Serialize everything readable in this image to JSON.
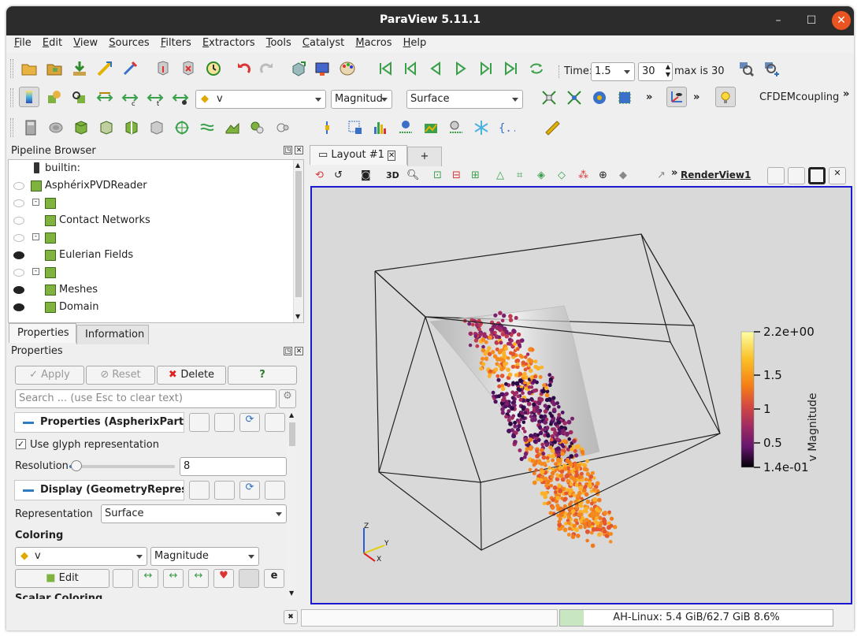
{
  "window": {
    "title": "ParaView 5.11.1"
  },
  "menu": [
    "File",
    "Edit",
    "View",
    "Sources",
    "Filters",
    "Extractors",
    "Tools",
    "Catalyst",
    "Macros",
    "Help"
  ],
  "toolbar_time": {
    "time_label": "Time:",
    "time_value": "1.5",
    "step_value": "30",
    "max_label": "max is 30"
  },
  "toolbar_color": {
    "array_value": "v",
    "component_value": "Magnitud",
    "representation_value": "Surface",
    "more": "»",
    "plugin_label": "CFDEMcoupling",
    "more2": "»"
  },
  "pipeline": {
    "title": "Pipeline Browser",
    "items": [
      {
        "label": "builtin:",
        "visible": "none"
      },
      {
        "label": "AsphérixPVDReader",
        "visible": "hidden"
      },
      {
        "label": "",
        "visible": "hidden"
      },
      {
        "label": "Contact Networks",
        "visible": "hidden"
      },
      {
        "label": "",
        "visible": "hidden"
      },
      {
        "label": "Eulerian Fields",
        "visible": "shown"
      },
      {
        "label": "",
        "visible": "hidden"
      },
      {
        "label": "Meshes",
        "visible": "shown"
      },
      {
        "label": "Domain",
        "visible": "shown"
      }
    ]
  },
  "panel_tabs": {
    "properties": "Properties",
    "information": "Information"
  },
  "properties": {
    "title": "Properties",
    "apply": "Apply",
    "reset": "Reset",
    "delete": "Delete",
    "help": "?",
    "search_placeholder": "Search ... (use Esc to clear text)",
    "section_properties": "Properties (AspherixParti",
    "glyph_label": "Use glyph representation",
    "resolution_label": "Resolution",
    "resolution_value": "8",
    "resolution_fraction": 0.06,
    "section_display": "Display (GeometryRepres",
    "representation_label": "Representation",
    "representation_value": "Surface",
    "coloring_label": "Coloring",
    "color_array": "v",
    "color_component": "Magnitude",
    "edit": "Edit",
    "scalar_coloring": "Scalar Coloring"
  },
  "layout": {
    "tab_label": "Layout #1",
    "add_tab": "+",
    "view_label": "RenderView1",
    "toolbar_3d": "3D",
    "more": "»"
  },
  "colorbar": {
    "title": "v Magnitude",
    "ticks": [
      "2.2e+00",
      "1.5",
      "1",
      "0.5",
      "1.4e-01"
    ]
  },
  "axes": {
    "x": "X",
    "y": "Y",
    "z": "Z"
  },
  "status": {
    "memory": "AH-Linux: 5.4 GiB/62.7 GiB 8.6%"
  },
  "colors": {
    "title_bg": "#2c2c2c",
    "close": "#e95420",
    "view_border": "#1a1ad0",
    "view_bg": "#d9d9d9"
  }
}
